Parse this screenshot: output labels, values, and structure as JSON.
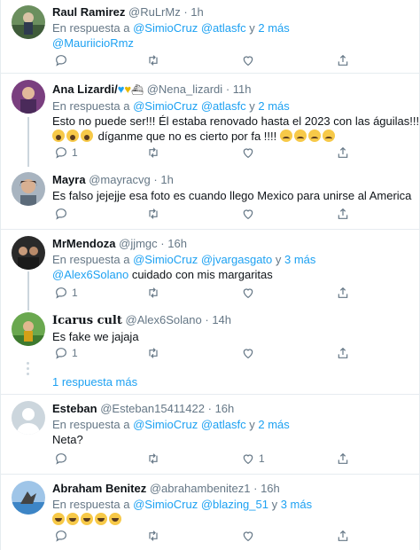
{
  "colors": {
    "accent": "#1da1f2",
    "muted": "#657786",
    "border": "#e6ecf0"
  },
  "reply_prefix": "En respuesta a",
  "and_word": "y",
  "show_more_replies": "1 respuesta más",
  "tweets": [
    {
      "name": "Raul Ramirez",
      "handle": "@RuLrMz",
      "dot": "·",
      "time": "1h",
      "reply_to_1": "@SimioCruz",
      "reply_to_2": "@atlasfc",
      "reply_more": "2 más",
      "text_lines": [
        "@MauriicioRmz"
      ],
      "reply_count": "",
      "icons": [
        "reply-icon",
        "retweet-icon",
        "like-icon",
        "share-icon"
      ]
    },
    {
      "name": "Ana Lizardi/",
      "handle": "@Nena_lizardi",
      "dot": "·",
      "time": "11h",
      "reply_to_1": "@SimioCruz",
      "reply_to_2": "@atlasfc",
      "reply_more": "2 más",
      "text_lines": [
        "Esto no puede ser!!! Él estaba renovado hasta el 2023 con las águilas!!!",
        "díganme que no es cierto por fa !!!!"
      ],
      "reply_count": "1",
      "icons": [
        "reply-icon",
        "retweet-icon",
        "like-icon",
        "share-icon"
      ]
    },
    {
      "name": "Mayra",
      "handle": "@mayracvg",
      "dot": "·",
      "time": "1h",
      "text_lines": [
        "Es falso jejejje esa foto es cuando llego Mexico para unirse al America"
      ],
      "reply_count": "",
      "icons": [
        "reply-icon",
        "retweet-icon",
        "like-icon",
        "share-icon"
      ]
    },
    {
      "name": "MrMendoza",
      "handle": "@jjmgc",
      "dot": "·",
      "time": "16h",
      "reply_to_1": "@SimioCruz",
      "reply_to_2": "@jvargasgato",
      "reply_more": "3 más",
      "text_link": "@Alex6Solano",
      "text_rest": " cuidado con mis margaritas",
      "reply_count": "1",
      "icons": [
        "reply-icon",
        "retweet-icon",
        "like-icon",
        "share-icon"
      ]
    },
    {
      "name": "Icarus cult",
      "handle": "@Alex6Solano",
      "dot": "·",
      "time": "14h",
      "text_lines": [
        "Es fake we jajaja"
      ],
      "reply_count": "1",
      "icons": [
        "reply-icon",
        "retweet-icon",
        "like-icon",
        "share-icon"
      ]
    },
    {
      "name": "Esteban",
      "handle": "@Esteban15411422",
      "dot": "·",
      "time": "16h",
      "reply_to_1": "@SimioCruz",
      "reply_to_2": "@atlasfc",
      "reply_more": "2 más",
      "text_lines": [
        "Neta?"
      ],
      "like_count": "1",
      "icons": [
        "reply-icon",
        "retweet-icon",
        "like-icon",
        "share-icon"
      ]
    },
    {
      "name": "Abraham Benitez",
      "handle": "@abrahambenitez1",
      "dot": "·",
      "time": "16h",
      "reply_to_1": "@SimioCruz",
      "reply_to_2": "@blazing_51",
      "reply_more": "3 más",
      "text_lines": [
        ""
      ],
      "icons": [
        "reply-icon",
        "retweet-icon",
        "like-icon",
        "share-icon"
      ]
    }
  ]
}
